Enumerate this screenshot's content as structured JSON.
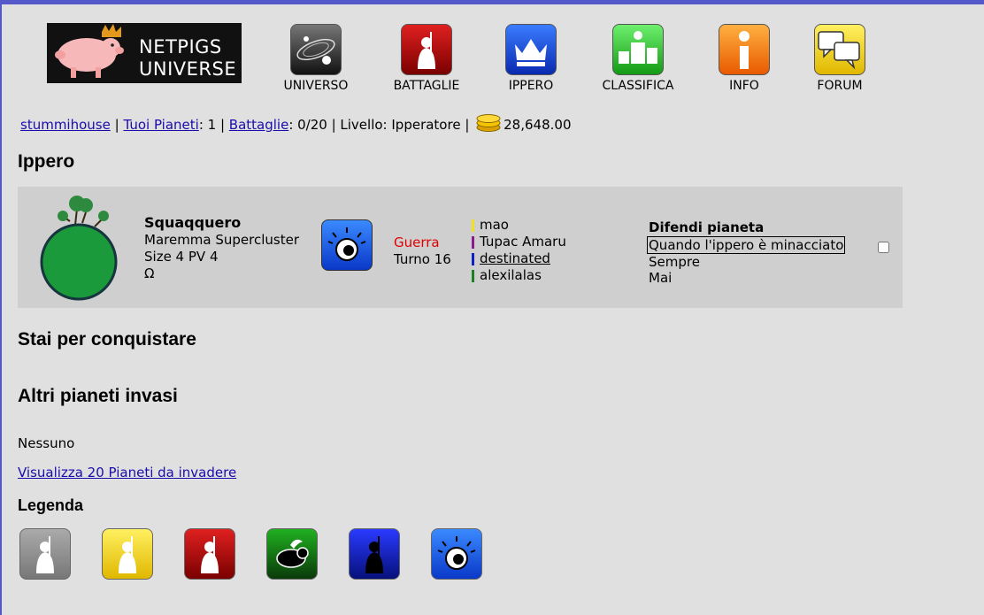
{
  "logo": {
    "line1": "NETPIGS",
    "line2": "UNIVERSE"
  },
  "nav": [
    {
      "label": "UNIVERSO",
      "icon": "universe-icon"
    },
    {
      "label": "BATTAGLIE",
      "icon": "battle-icon"
    },
    {
      "label": "IPPERO",
      "icon": "crown-icon"
    },
    {
      "label": "CLASSIFICA",
      "icon": "ranking-icon"
    },
    {
      "label": "INFO",
      "icon": "info-icon"
    },
    {
      "label": "FORUM",
      "icon": "forum-icon"
    }
  ],
  "status": {
    "user": "stummihouse",
    "sep1": " | ",
    "planets_link": "Tuoi Pianeti",
    "planets_value": ": 1 | ",
    "battles_link": "Battaglie",
    "battles_value": ": 0/20 | Livello: Ipperatore | ",
    "coins": "28,648.00"
  },
  "sections": {
    "ippero": "Ippero",
    "conquering": "Stai per conquistare",
    "invaded": "Altri pianeti invasi",
    "none": "Nessuno",
    "view_link": "Visualizza 20 Pianeti da invadere",
    "legend": "Legenda"
  },
  "planet": {
    "name": "Squaqquero",
    "cluster": "Maremma Supercluster",
    "stats": "Size 4 PV 4",
    "symbol": "Ω",
    "state": "Guerra",
    "turn": "Turno 16",
    "players": [
      {
        "name": "mao",
        "color": "#f0e020",
        "link": false
      },
      {
        "name": "Tupac Amaru",
        "color": "#8b1a8b",
        "link": false
      },
      {
        "name": "destinated",
        "color": "#1020c0",
        "link": true
      },
      {
        "name": "alexilalas",
        "color": "#208020",
        "link": false
      }
    ],
    "defend_title": "Difendi pianeta",
    "defend_options": [
      "Quando l'ippero è minacciato",
      "Sempre",
      "Mai"
    ]
  },
  "colors": {
    "war": "#e00000",
    "planet": "#1a9a3a",
    "card": "#cfcfcf",
    "border": "#5558c8"
  }
}
